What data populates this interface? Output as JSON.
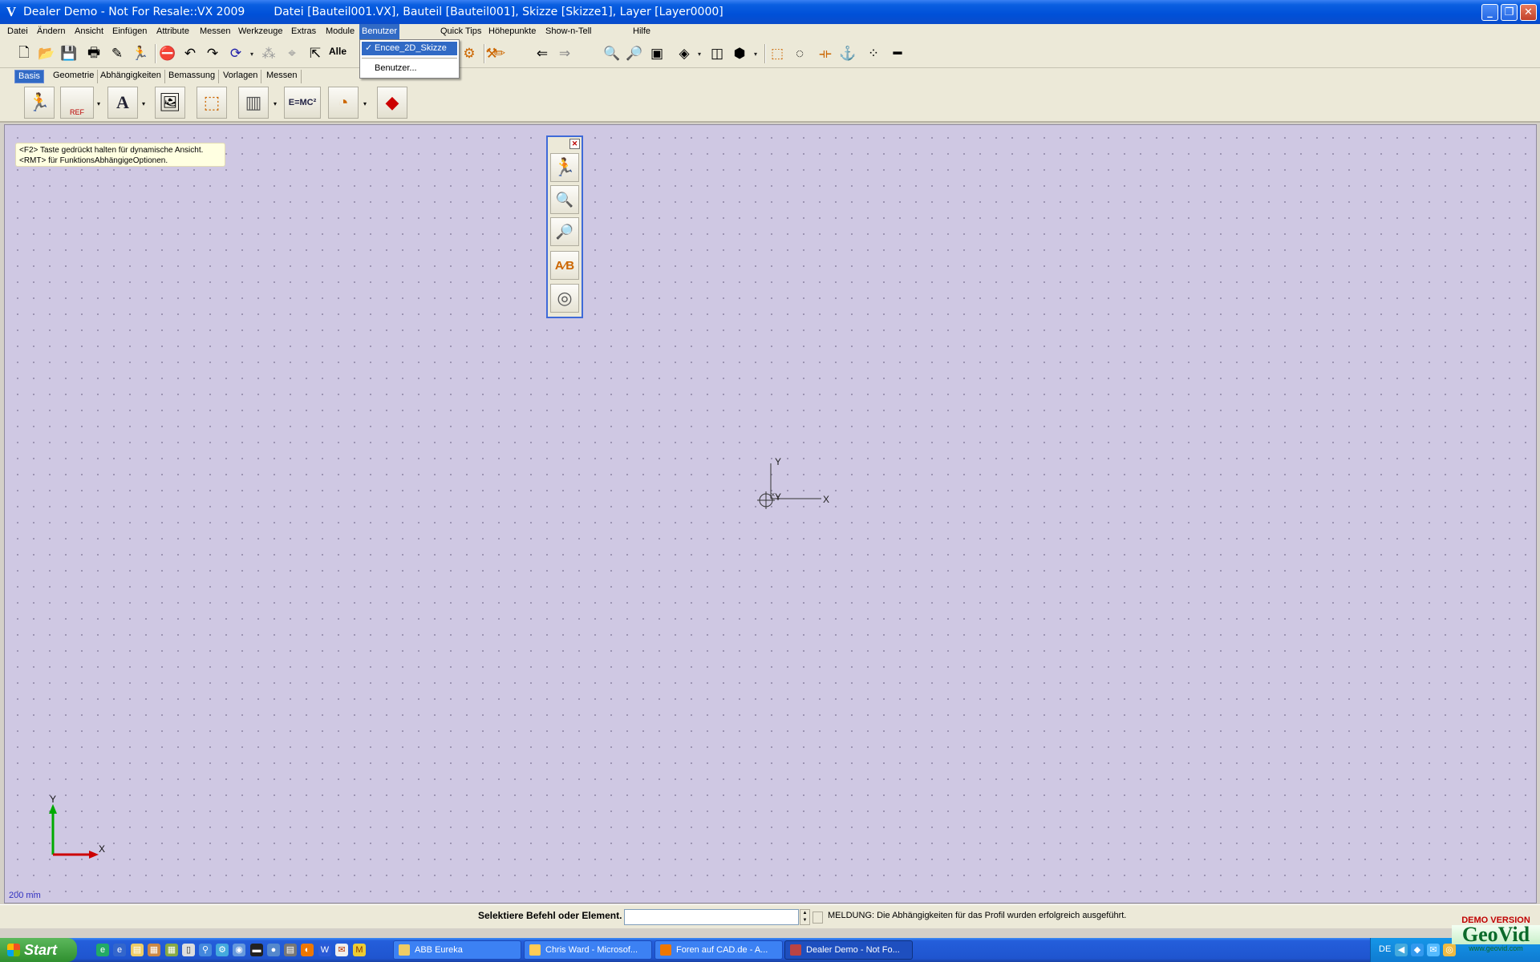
{
  "window": {
    "title_left": "Dealer Demo - Not For Resale::VX 2009",
    "title_right": "Datei [Bauteil001.VX],  Bauteil [Bauteil001],  Skizze [Skizze1],  Layer [Layer0000]",
    "app_icon": "vx-logo-icon",
    "controls": [
      "minimize-icon",
      "restore-icon",
      "close-icon"
    ]
  },
  "menu": {
    "items": [
      "Datei",
      "Ändern",
      "Ansicht",
      "Einfügen",
      "Attribute",
      "Messen",
      "Werkzeuge",
      "Extras",
      "Module",
      "Benutzer",
      "Quick Tips",
      "Höhepunkte",
      "Show-n-Tell",
      "Hilfe"
    ],
    "active": "Benutzer",
    "dropdown": {
      "checked_item": "Encee_2D_Skizze",
      "item2": "Benutzer...",
      "check_glyph": "✓"
    }
  },
  "toolbar": {
    "filter_label": "Alle"
  },
  "tabs": [
    "Basis",
    "Geometrie",
    "Abhängigkeiten",
    "Bemassung",
    "Vorlagen",
    "Messen"
  ],
  "active_tab": "Basis",
  "ribbon": {
    "ref_label": "REF",
    "text_label": "A",
    "formula_label": "E=MC²"
  },
  "canvas": {
    "tip_line1": "<F2> Taste gedrückt halten für dynamische Ansicht.",
    "tip_line2": "<RMT> für FunktionsAbhängigeOptionen.",
    "axis_x": "X",
    "axis_y": "Y",
    "scale": "200 mm",
    "background_color": "#cfc8e3"
  },
  "palette": {
    "icons": [
      "exit-sketch-icon",
      "zoom-in-icon",
      "zoom-out-icon",
      "text-style-icon",
      "spiral-icon"
    ]
  },
  "status": {
    "prompt": "Selektiere Befehl oder Element.",
    "input_value": "",
    "message": "MELDUNG: Die Abhängigkeiten für das Profil wurden erfolgreich ausgeführt."
  },
  "watermark": {
    "demo": "DEMO VERSION",
    "brand": "GeoVid",
    "url": "www.geovid.com"
  },
  "taskbar": {
    "start": "Start",
    "tasks": [
      "ABB Eureka",
      "Chris Ward - Microsof...",
      "Foren auf CAD.de - A...",
      "Dealer Demo - Not Fo..."
    ],
    "active_task": "Dealer Demo - Not Fo...",
    "lang": "DE"
  },
  "colors": {
    "titlebar": "#0a5fe0",
    "selection": "#316ac5",
    "axis_x": "#cc0000",
    "axis_y": "#00aa00"
  }
}
